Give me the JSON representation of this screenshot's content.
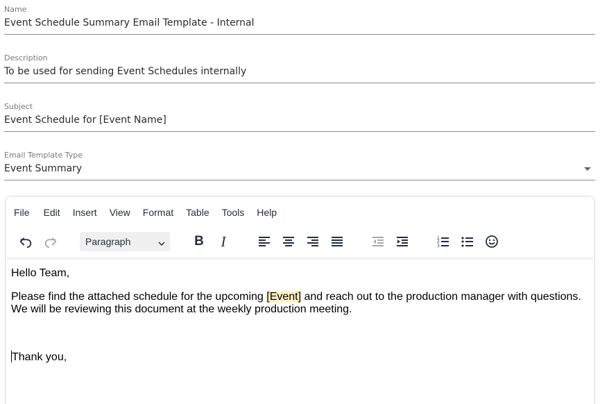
{
  "form": {
    "name": {
      "label": "Name",
      "value": "Event Schedule Summary Email Template - Internal"
    },
    "description": {
      "label": "Description",
      "value": "To be used for sending Event Schedules internally"
    },
    "subject": {
      "label": "Subject",
      "value": "Event Schedule for [Event Name]"
    },
    "template_type": {
      "label": "Email Template Type",
      "value": "Event Summary"
    }
  },
  "editor": {
    "menu": [
      "File",
      "Edit",
      "Insert",
      "View",
      "Format",
      "Table",
      "Tools",
      "Help"
    ],
    "block_format": "Paragraph",
    "icons": [
      "undo-icon",
      "redo-icon",
      "bold-icon",
      "italic-icon",
      "align-left-icon",
      "align-center-icon",
      "align-right-icon",
      "justify-icon",
      "outdent-icon",
      "indent-icon",
      "numbered-list-icon",
      "bullet-list-icon",
      "emoji-icon"
    ],
    "content": {
      "greeting": "Hello Team,",
      "body_before": "Please find the attached schedule for the upcoming ",
      "placeholder": "[Event]",
      "body_after": " and reach out to the production manager with questions. We will be reviewing this document at the weekly production meeting.",
      "signoff": "Thank you,"
    }
  },
  "colors": {
    "placeholder_highlight": "#fdf1c4",
    "toolbar_text": "#222f3e",
    "field_underline": "#8a8a8a"
  }
}
